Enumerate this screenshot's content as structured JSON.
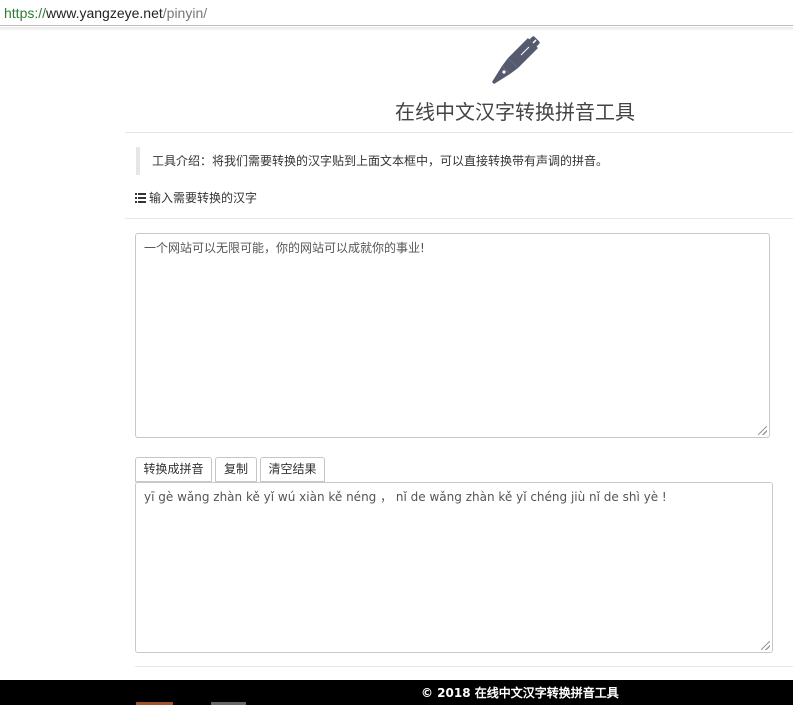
{
  "browser": {
    "url_scheme": "https://",
    "url_host": "www.yangzeye.net",
    "url_path": "/pinyin/"
  },
  "header": {
    "logo_icon": "fountain-pen-icon",
    "title": "在线中文汉字转换拼音工具"
  },
  "intro": {
    "text": "工具介绍：将我们需要转换的汉字贴到上面文本框中，可以直接转换带有声调的拼音。"
  },
  "input_section": {
    "icon": "list-icon",
    "label": "输入需要转换的汉字",
    "value": "一个网站可以无限可能，你的网站可以成就你的事业!"
  },
  "toolbar": {
    "convert_label": "转换成拼音",
    "copy_label": "复制",
    "clear_label": "清空结果"
  },
  "output": {
    "value": "yī gè wǎng zhàn kě yǐ wú xiàn kě néng ， nǐ de wǎng zhàn kě yǐ chéng jiù nǐ de shì yè !"
  },
  "footer": {
    "text": "© 2018 在线中文汉字转换拼音工具"
  },
  "colors": {
    "url_scheme": "#2e7d32",
    "logo": "#555a6e",
    "footer_bg": "#000000"
  }
}
